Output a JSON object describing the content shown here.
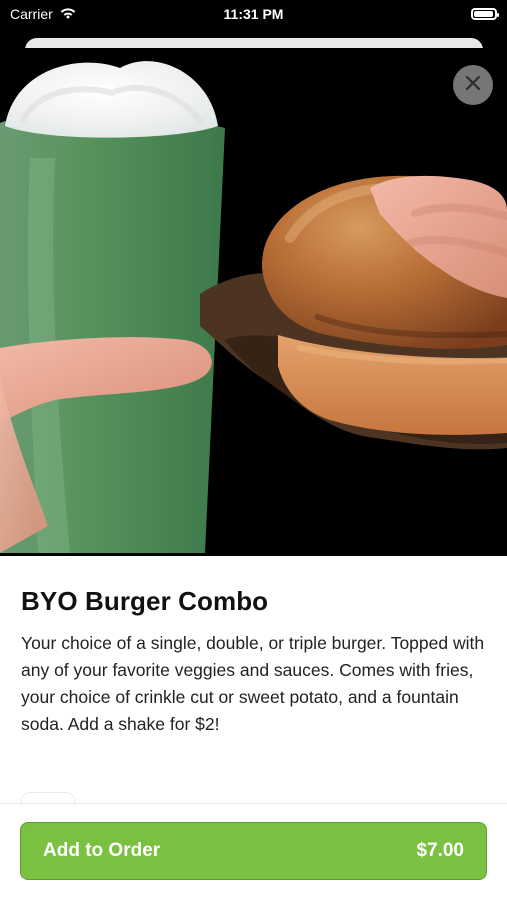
{
  "status_bar": {
    "carrier": "Carrier",
    "time": "11:31 PM",
    "wifi_icon": "wifi-icon",
    "battery_icon": "battery-icon"
  },
  "product": {
    "title": "BYO Burger Combo",
    "description": "Your choice of a single, double, or triple burger. Topped with any of your favorite veggies and sauces. Comes with fries, your choice of crinkle cut or sweet potato, and a fountain soda. Add a shake for $2!",
    "image_description": "green milkshake and burger photo"
  },
  "actions": {
    "add_label": "Add to Order",
    "price": "$7.00",
    "close_icon": "close-icon"
  },
  "colors": {
    "accent": "#7ac142",
    "accent_border": "#5f9c33",
    "close_bg": "#808080"
  }
}
